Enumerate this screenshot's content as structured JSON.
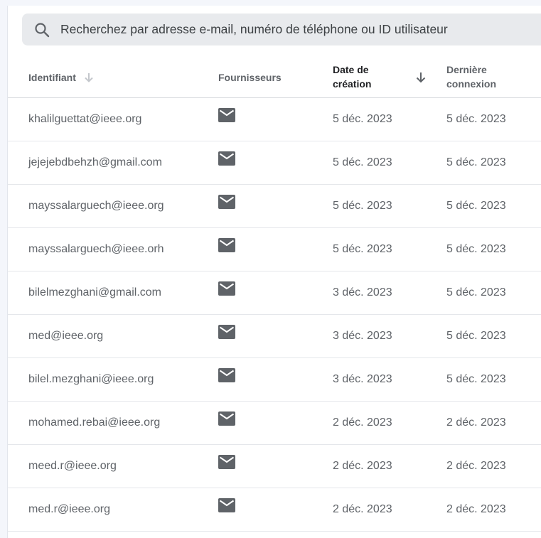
{
  "search": {
    "placeholder": "Recherchez par adresse e-mail, numéro de téléphone ou ID utilisateur",
    "icon": "search-icon"
  },
  "table": {
    "columns": {
      "identifier": "Identifiant",
      "providers": "Fournisseurs",
      "created": "Date de création",
      "last_login": "Dernière connexion"
    },
    "sort": {
      "column": "created",
      "direction": "descending"
    },
    "rows": [
      {
        "identifier": "khalilguettat@ieee.org",
        "provider_icon": "mail-icon",
        "created": "5 déc. 2023",
        "last_login": "5 déc. 2023"
      },
      {
        "identifier": "jejejebdbehzh@gmail.com",
        "provider_icon": "mail-icon",
        "created": "5 déc. 2023",
        "last_login": "5 déc. 2023"
      },
      {
        "identifier": "mayssalarguech@ieee.org",
        "provider_icon": "mail-icon",
        "created": "5 déc. 2023",
        "last_login": "5 déc. 2023"
      },
      {
        "identifier": "mayssalarguech@ieee.orh",
        "provider_icon": "mail-icon",
        "created": "5 déc. 2023",
        "last_login": "5 déc. 2023"
      },
      {
        "identifier": "bilelmezghani@gmail.com",
        "provider_icon": "mail-icon",
        "created": "3 déc. 2023",
        "last_login": "5 déc. 2023"
      },
      {
        "identifier": "med@ieee.org",
        "provider_icon": "mail-icon",
        "created": "3 déc. 2023",
        "last_login": "5 déc. 2023"
      },
      {
        "identifier": "bilel.mezghani@ieee.org",
        "provider_icon": "mail-icon",
        "created": "3 déc. 2023",
        "last_login": "5 déc. 2023"
      },
      {
        "identifier": "mohamed.rebai@ieee.org",
        "provider_icon": "mail-icon",
        "created": "2 déc. 2023",
        "last_login": "2 déc. 2023"
      },
      {
        "identifier": "meed.r@ieee.org",
        "provider_icon": "mail-icon",
        "created": "2 déc. 2023",
        "last_login": "2 déc. 2023"
      },
      {
        "identifier": "med.r@ieee.org",
        "provider_icon": "mail-icon",
        "created": "2 déc. 2023",
        "last_login": "2 déc. 2023"
      }
    ]
  },
  "colors": {
    "page_bg": "#f4f6fb",
    "search_bg": "#e8eaed",
    "text": "#5f6368",
    "header_active": "#202124",
    "icon": "#5f6368"
  }
}
